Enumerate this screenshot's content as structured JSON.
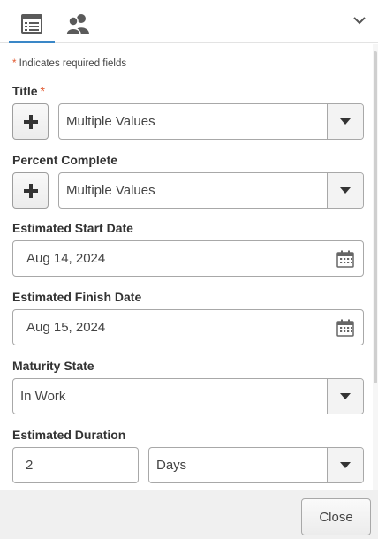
{
  "tabs": [
    {
      "name": "form-tab",
      "icon": "form-list-icon",
      "active": true
    },
    {
      "name": "people-tab",
      "icon": "users-icon",
      "active": false
    }
  ],
  "collapse_icon": "chevron-down-icon",
  "required_note": {
    "star": "*",
    "text": " Indicates required fields"
  },
  "fields": {
    "title": {
      "label": "Title",
      "required_star": "*",
      "value": "Multiple Values"
    },
    "percent_complete": {
      "label": "Percent Complete",
      "value": "Multiple Values"
    },
    "start_date": {
      "label": "Estimated Start Date",
      "value": "Aug 14, 2024"
    },
    "finish_date": {
      "label": "Estimated Finish Date",
      "value": "Aug 15, 2024"
    },
    "maturity_state": {
      "label": "Maturity State",
      "value": "In Work"
    },
    "duration": {
      "label": "Estimated Duration",
      "value": "2",
      "unit": "Days"
    }
  },
  "footer": {
    "close_label": "Close"
  },
  "colors": {
    "accent": "#3a87c7",
    "required": "#e2592f",
    "icon": "#5a5a5a"
  }
}
